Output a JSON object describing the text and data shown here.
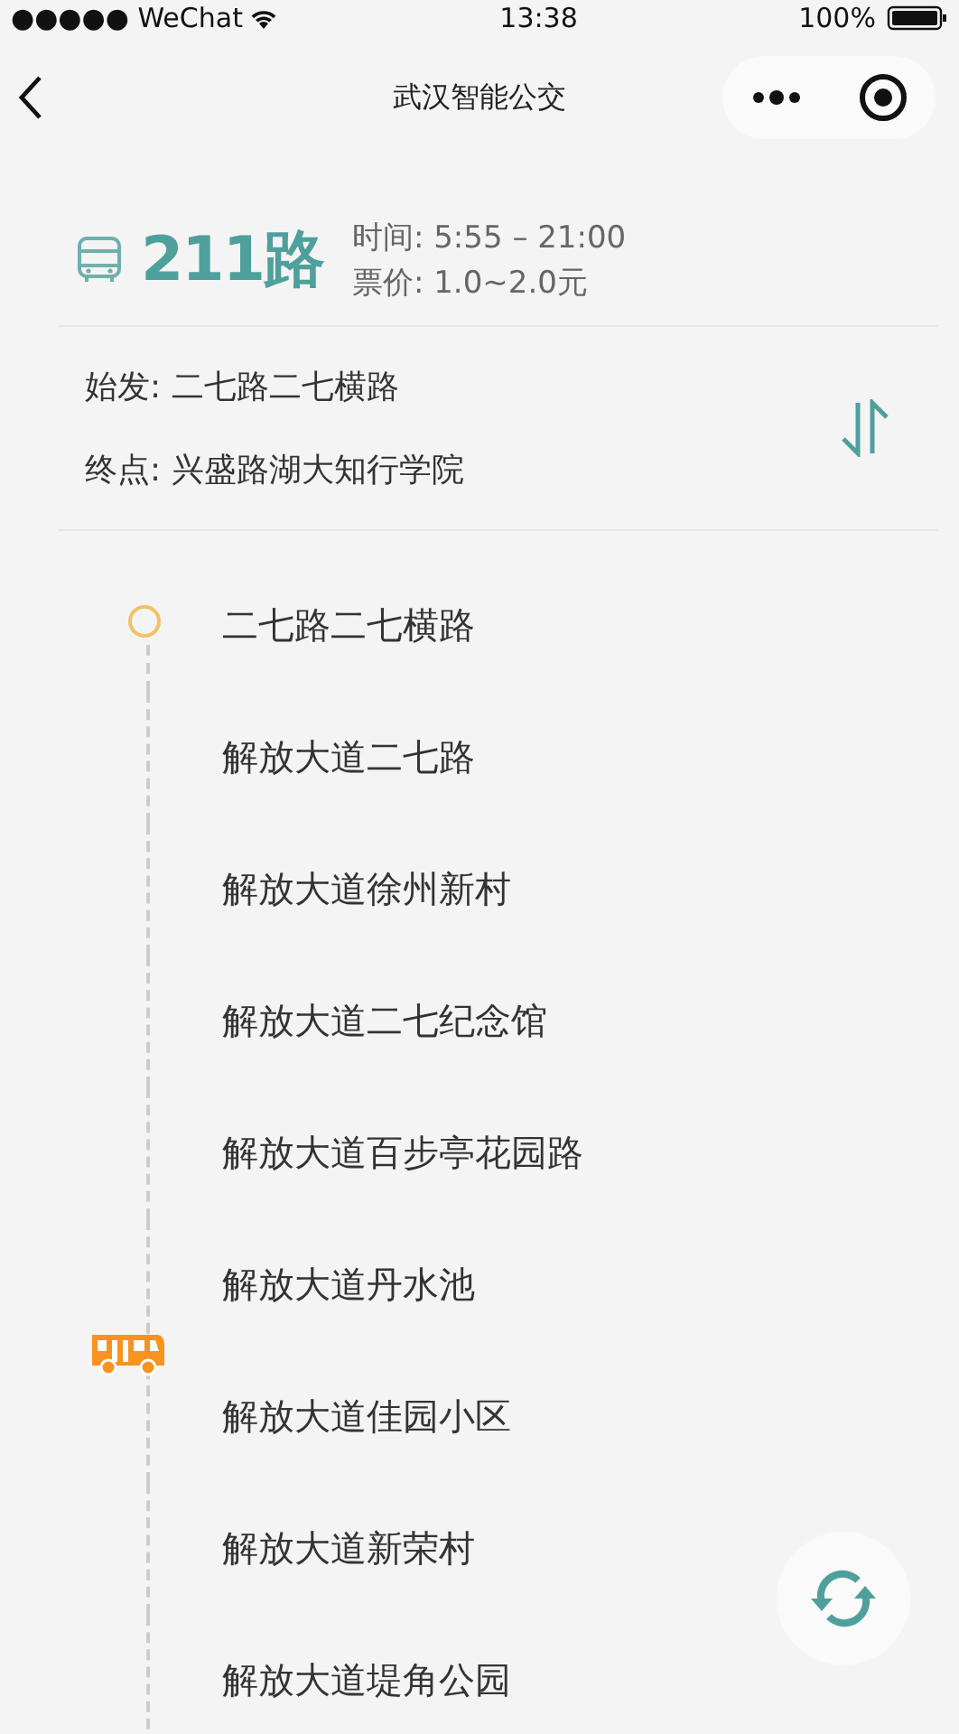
{
  "status_bar": {
    "carrier": "●●●●● WeChat",
    "time": "13:38",
    "battery": "100%"
  },
  "nav": {
    "title": "武汉智能公交"
  },
  "route": {
    "name": "211路",
    "time": "时间: 5:55 – 21:00",
    "fare": "票价: 1.0~2.0元"
  },
  "ends": {
    "origin": "始发: 二七路二七横路",
    "terminus": "终点: 兴盛路湖大知行学院"
  },
  "stops": [
    {
      "name": "二七路二七横路",
      "kind": "start",
      "bus": false
    },
    {
      "name": "解放大道二七路",
      "kind": "stop",
      "bus": false
    },
    {
      "name": "解放大道徐州新村",
      "kind": "stop",
      "bus": false
    },
    {
      "name": "解放大道二七纪念馆",
      "kind": "stop",
      "bus": false
    },
    {
      "name": "解放大道百步亭花园路",
      "kind": "stop",
      "bus": false
    },
    {
      "name": "解放大道丹水池",
      "kind": "stop",
      "bus": false
    },
    {
      "name": "解放大道佳园小区",
      "kind": "stop",
      "bus": true
    },
    {
      "name": "解放大道新荣村",
      "kind": "stop",
      "bus": false
    },
    {
      "name": "解放大道堤角公园",
      "kind": "stop",
      "bus": false
    }
  ]
}
